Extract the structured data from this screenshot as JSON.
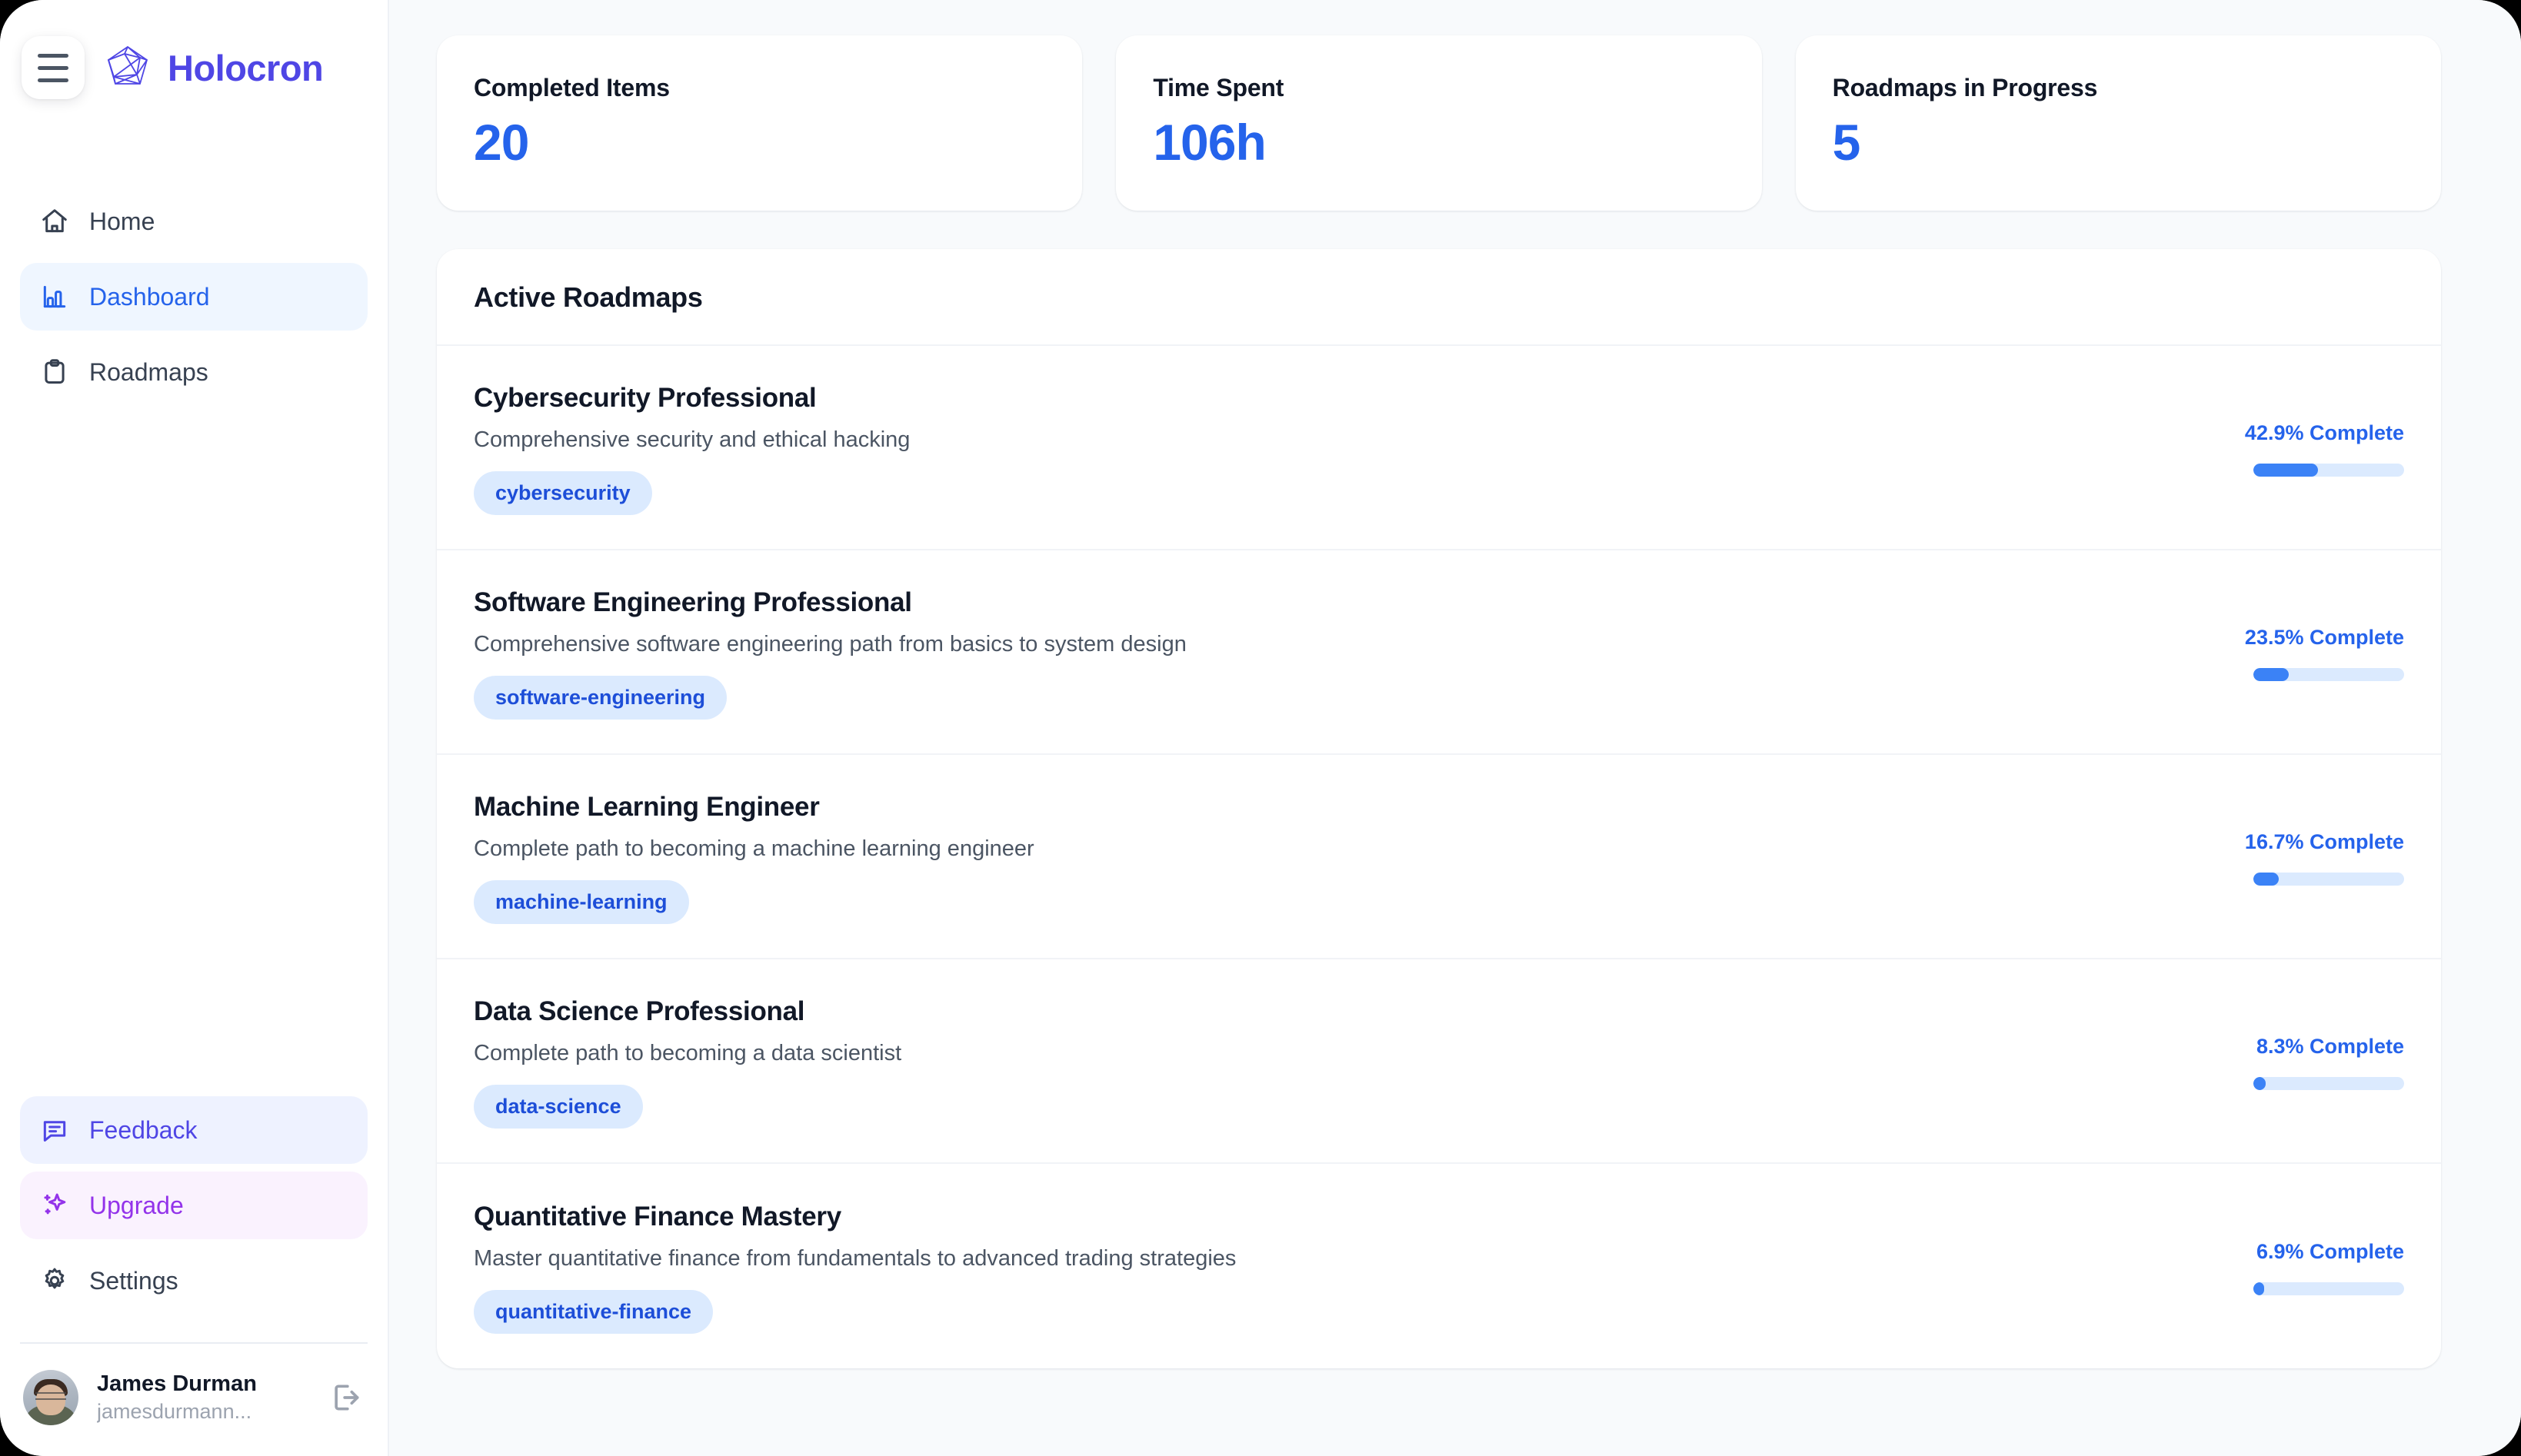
{
  "brand": {
    "name": "Holocron",
    "logo_icon": "polyhedron-logo-icon",
    "menu_icon": "hamburger-menu-icon",
    "accent": "#4f46e5"
  },
  "sidebar": {
    "nav": [
      {
        "label": "Home",
        "icon": "home-icon",
        "state": "default"
      },
      {
        "label": "Dashboard",
        "icon": "bar-chart-icon",
        "state": "active"
      },
      {
        "label": "Roadmaps",
        "icon": "clipboard-icon",
        "state": "default"
      }
    ],
    "bottom_nav": [
      {
        "label": "Feedback",
        "icon": "message-square-icon",
        "state": "feedback"
      },
      {
        "label": "Upgrade",
        "icon": "sparkles-icon",
        "state": "upgrade"
      },
      {
        "label": "Settings",
        "icon": "gear-icon",
        "state": "default"
      }
    ],
    "user": {
      "name": "James Durman",
      "handle": "jamesdurmann...",
      "avatar_icon": "user-avatar",
      "logout_icon": "logout-icon"
    }
  },
  "main": {
    "stats": [
      {
        "label": "Completed Items",
        "value": "20"
      },
      {
        "label": "Time Spent",
        "value": "106h"
      },
      {
        "label": "Roadmaps in Progress",
        "value": "5"
      }
    ],
    "panel": {
      "title": "Active Roadmaps",
      "roadmaps": [
        {
          "title": "Cybersecurity Professional",
          "description": "Comprehensive security and ethical hacking",
          "tag": "cybersecurity",
          "percent_label": "42.9% Complete",
          "percent": 42.9
        },
        {
          "title": "Software Engineering Professional",
          "description": "Comprehensive software engineering path from basics to system design",
          "tag": "software-engineering",
          "percent_label": "23.5% Complete",
          "percent": 23.5
        },
        {
          "title": "Machine Learning Engineer",
          "description": "Complete path to becoming a machine learning engineer",
          "tag": "machine-learning",
          "percent_label": "16.7% Complete",
          "percent": 16.7
        },
        {
          "title": "Data Science Professional",
          "description": "Complete path to becoming a data scientist",
          "tag": "data-science",
          "percent_label": "8.3% Complete",
          "percent": 8.3
        },
        {
          "title": "Quantitative Finance Mastery",
          "description": "Master quantitative finance from fundamentals to advanced trading strategies",
          "tag": "quantitative-finance",
          "percent_label": "6.9% Complete",
          "percent": 6.9
        }
      ]
    }
  },
  "colors": {
    "accent_blue": "#2563eb",
    "progress_fill": "#3b82f6",
    "progress_track": "#dbeafe",
    "tag_bg": "#dbeafe",
    "tag_text": "#1d4ed8",
    "upgrade_purple": "#9333ea",
    "feedback_indigo": "#4f46e5"
  }
}
